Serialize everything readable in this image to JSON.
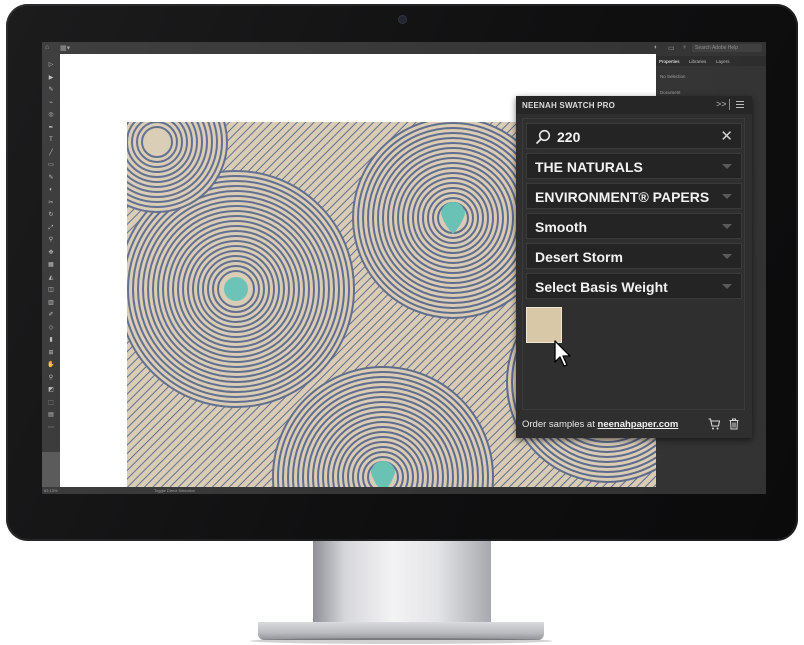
{
  "app": {
    "search_placeholder": "Search Adobe Help",
    "panel_tabs": [
      "Properties",
      "Libraries",
      "Layers"
    ],
    "panel_rows": [
      "No Selection",
      "Document"
    ],
    "status_zoom": "83.13%",
    "status_tool": "Toggle Direct Selection"
  },
  "neenah": {
    "title": "NEENAH SWATCH PRO",
    "collapse_glyph": ">>",
    "search_icon": "search-icon",
    "search_value": "220",
    "clear_glyph": "✕",
    "selects": [
      "THE NATURALS",
      "ENVIRONMENT® PAPERS",
      "Smooth",
      "Desert Storm",
      "Select Basis Weight"
    ],
    "swatch_color": "#d8c8a8",
    "footer_prefix": "Order samples at",
    "footer_link": "neenahpaper.com",
    "cart_icon": "cart-icon",
    "trash_icon": "trash-icon"
  },
  "colors": {
    "pattern_bg": "#d9cbb3",
    "pattern_line": "#5c6a8c",
    "pattern_accent": "#67c1b4"
  }
}
